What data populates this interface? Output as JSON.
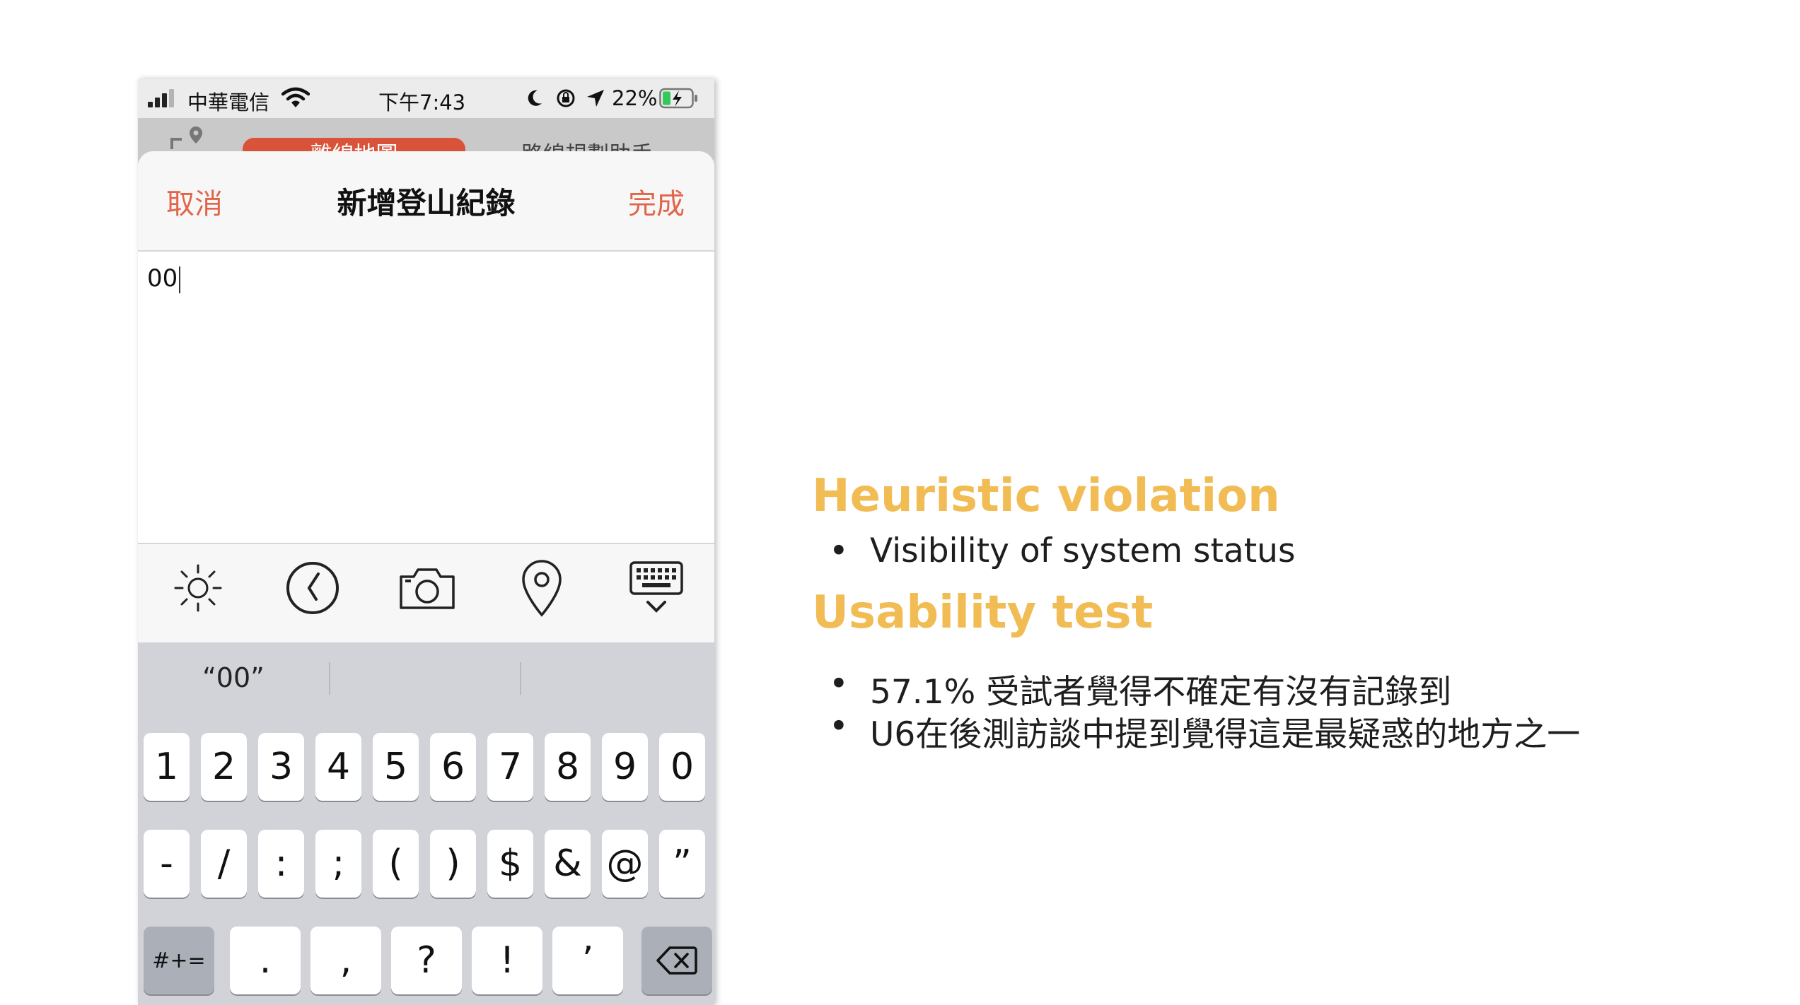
{
  "status_bar": {
    "carrier": "中華電信",
    "time": "下午7:43",
    "battery_percent": "22%"
  },
  "tabs": [
    {
      "label": "離線地圖",
      "selected": true
    },
    {
      "label": "路線規劃助手",
      "selected": false
    }
  ],
  "sheet": {
    "cancel_label": "取消",
    "title": "新增登山紀錄",
    "done_label": "完成",
    "note_value": "00"
  },
  "toolbar": {
    "icons": [
      "sun-icon",
      "clock-icon",
      "camera-icon",
      "location-pin-icon",
      "keyboard-dismiss-icon"
    ]
  },
  "keyboard": {
    "suggestions": [
      "“00”",
      "",
      ""
    ],
    "row1": [
      "1",
      "2",
      "3",
      "4",
      "5",
      "6",
      "7",
      "8",
      "9",
      "0"
    ],
    "row2": [
      "-",
      "/",
      ":",
      ";",
      "(",
      ")",
      "$",
      "&",
      "@",
      "”"
    ],
    "row3": [
      "#+=",
      ".",
      ",",
      "?",
      "!",
      "’"
    ]
  },
  "slide": {
    "heading1": "Heuristic violation",
    "heading1_bullets": [
      "Visibility of system status"
    ],
    "heading2": "Usability test",
    "heading2_bullets": [
      "57.1% 受試者覺得不確定有沒有記錄到",
      "U6在後測訪談中提到覺得這是最疑惑的地方之一"
    ]
  },
  "colors": {
    "accent": "#e0654a",
    "heading": "#f2bc55",
    "tab_selected": "#d9533a"
  }
}
